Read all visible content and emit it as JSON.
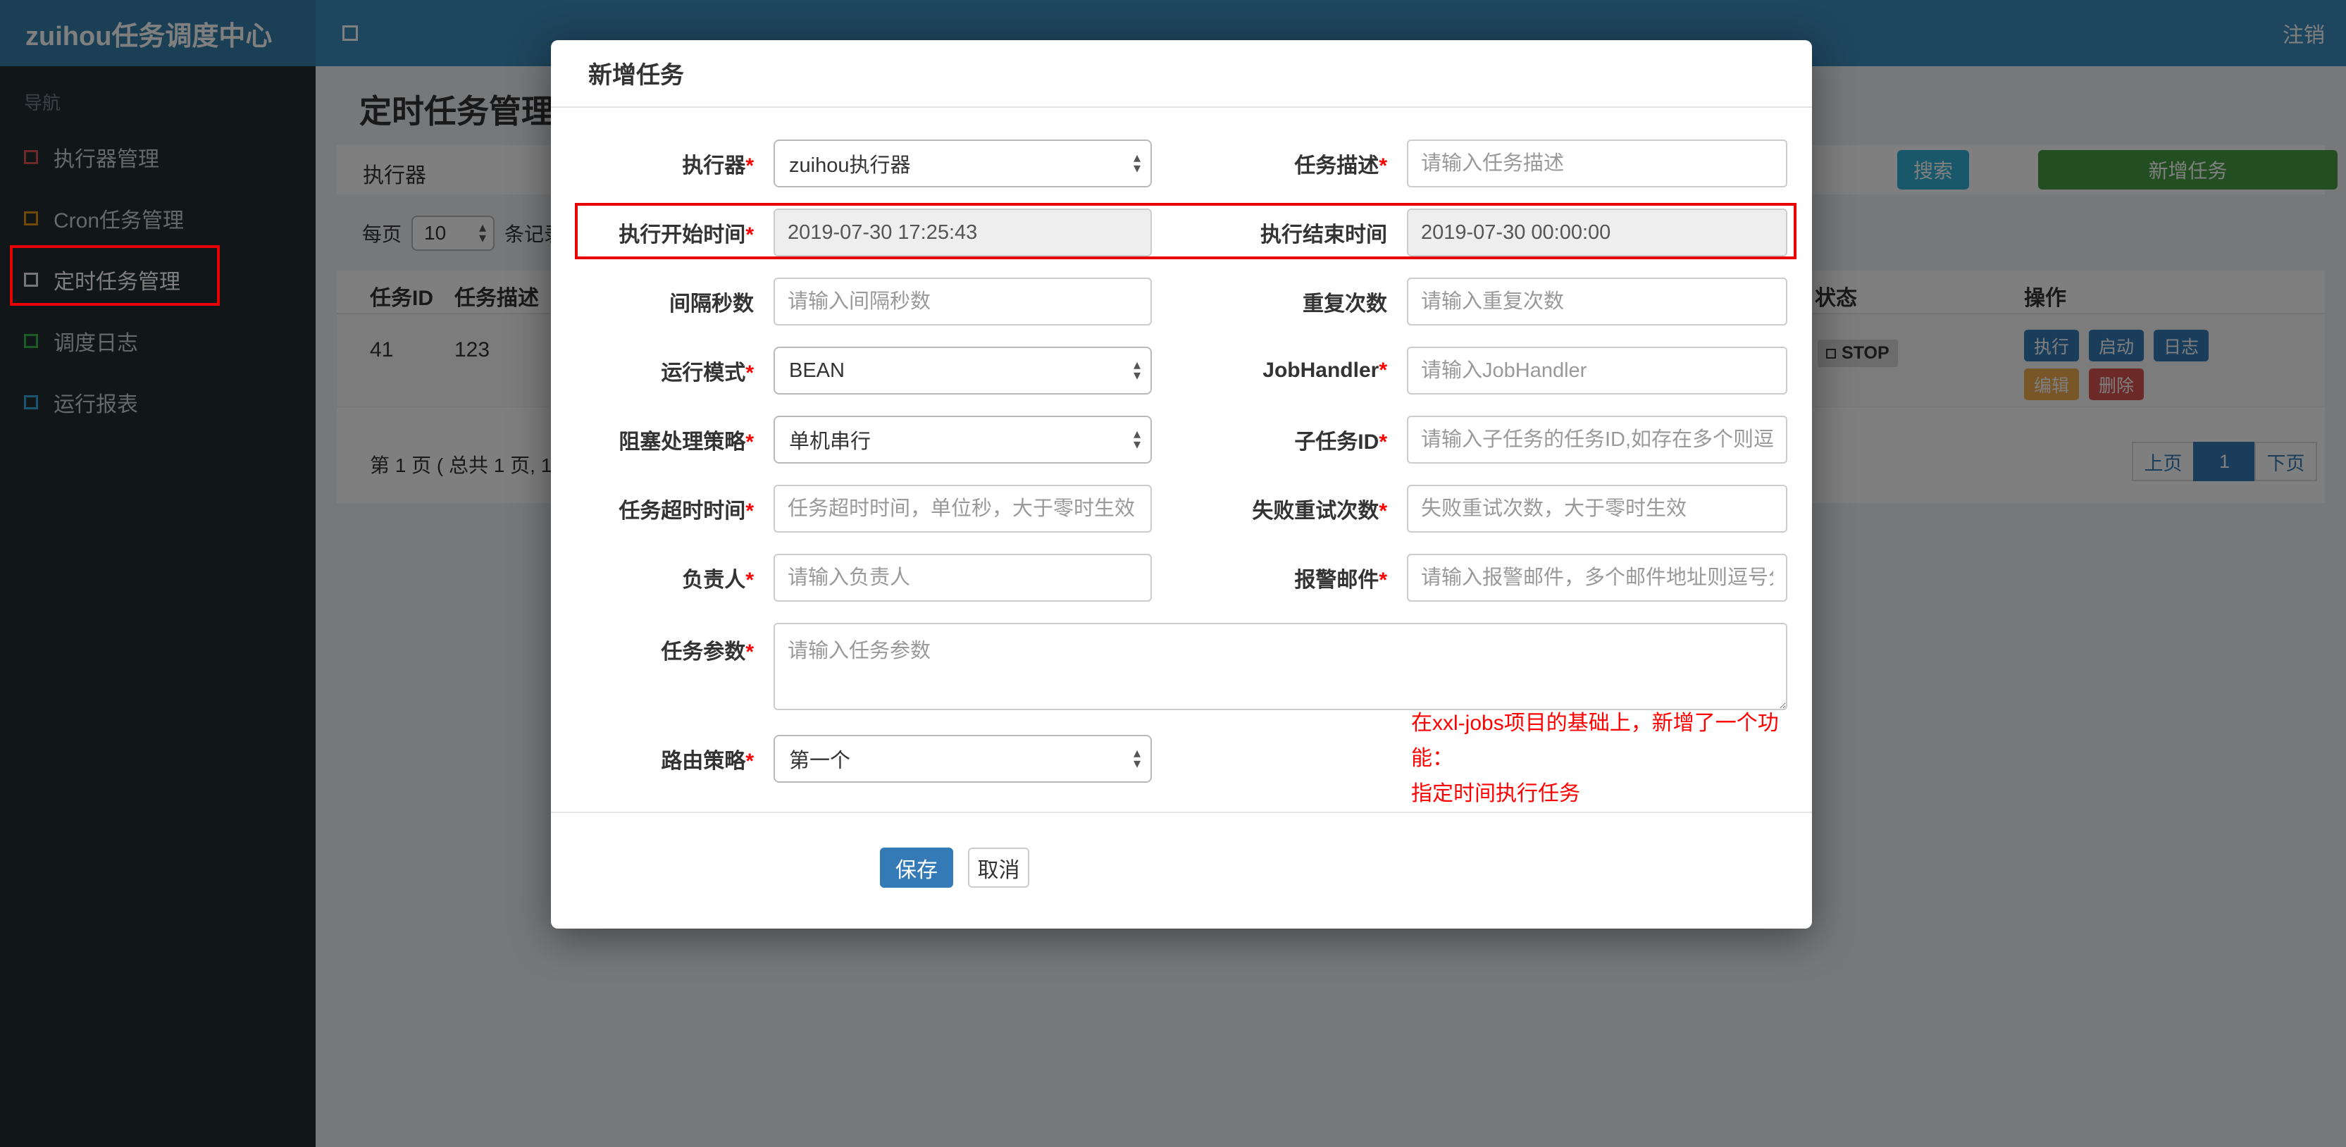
{
  "colors": {
    "navbar": "#3c8dbc",
    "brand_bg": "#367fa9",
    "sidebar": "#222d32",
    "accent_blue": "#337ab7",
    "teal": "#31b0d5",
    "green": "#449d44",
    "orange": "#f0ad4e",
    "red": "#d9534f",
    "annotation_red": "#e60000",
    "readonly_bg": "#eeeeee"
  },
  "icons": {
    "arrow_up": "▴",
    "arrow_down": "▾"
  },
  "navbar": {
    "brand": "zuihou任务调度中心",
    "logout": "注销"
  },
  "sidebar": {
    "section_label": "导航",
    "items": [
      {
        "label": "执行器管理",
        "icon_color": "#d9534f"
      },
      {
        "label": "Cron任务管理",
        "icon_color": "#e08e0b"
      },
      {
        "label": "定时任务管理",
        "icon_color": "#eeeeee"
      },
      {
        "label": "调度日志",
        "icon_color": "#39b54a"
      },
      {
        "label": "运行报表",
        "icon_color": "#36a9e1"
      }
    ]
  },
  "page": {
    "title": "定时任务管理"
  },
  "filter": {
    "executor_label": "执行器",
    "search_button": "搜索",
    "add_button": "新增任务"
  },
  "per_page": {
    "prefix": "每页",
    "value": "10",
    "suffix": "条记录"
  },
  "table": {
    "headers": {
      "id": "任务ID",
      "desc": "任务描述",
      "status": "状态",
      "ops": "操作"
    },
    "row": {
      "id": "41",
      "desc": "123",
      "status": "STOP",
      "buttons": {
        "run": "执行",
        "start": "启动",
        "log": "日志",
        "edit": "编辑",
        "delete": "删除"
      }
    }
  },
  "pagination": {
    "info": "第 1 页 ( 总共 1 页, 1",
    "prev": "上页",
    "current": "1",
    "next": "下页"
  },
  "modal": {
    "title": "新增任务",
    "rows": [
      {
        "left": {
          "label": "执行器",
          "star": "*",
          "value": "zuihou执行器"
        },
        "right": {
          "label": "任务描述",
          "star": "*",
          "placeholder": "请输入任务描述"
        }
      },
      {
        "left": {
          "label": "执行开始时间",
          "star": "*",
          "value": "2019-07-30 17:25:43"
        },
        "right": {
          "label": "执行结束时间",
          "star": "",
          "value": "2019-07-30 00:00:00"
        }
      },
      {
        "left": {
          "label": "间隔秒数",
          "star": "",
          "placeholder": "请输入间隔秒数"
        },
        "right": {
          "label": "重复次数",
          "star": "",
          "placeholder": "请输入重复次数"
        }
      },
      {
        "left": {
          "label": "运行模式",
          "star": "*",
          "value": "BEAN"
        },
        "right": {
          "label": "JobHandler",
          "star": "*",
          "placeholder": "请输入JobHandler"
        }
      },
      {
        "left": {
          "label": "阻塞处理策略",
          "star": "*",
          "value": "单机串行"
        },
        "right": {
          "label": "子任务ID",
          "star": "*",
          "placeholder": "请输入子任务的任务ID,如存在多个则逗号分隔"
        }
      },
      {
        "left": {
          "label": "任务超时时间",
          "star": "*",
          "placeholder": "任务超时时间，单位秒，大于零时生效"
        },
        "right": {
          "label": "失败重试次数",
          "star": "*",
          "placeholder": "失败重试次数，大于零时生效"
        }
      },
      {
        "left": {
          "label": "负责人",
          "star": "*",
          "placeholder": "请输入负责人"
        },
        "right": {
          "label": "报警邮件",
          "star": "*",
          "placeholder": "请输入报警邮件，多个邮件地址则逗号分隔"
        }
      }
    ],
    "params": {
      "label": "任务参数",
      "star": "*",
      "placeholder": "请输入任务参数"
    },
    "route": {
      "label": "路由策略",
      "star": "*",
      "value": "第一个"
    },
    "note_line1": "在xxl-jobs项目的基础上，新增了一个功能：",
    "note_line2": "指定时间执行任务",
    "save_button": "保存",
    "cancel_button": "取消"
  }
}
